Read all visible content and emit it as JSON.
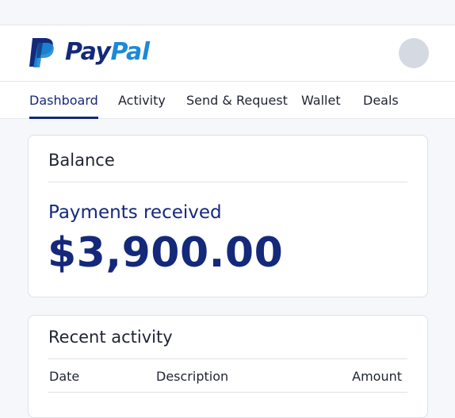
{
  "brand": {
    "name_part1": "Pay",
    "name_part2": "Pal",
    "colors": {
      "navy": "#14297a",
      "blue": "#1c8ad8"
    }
  },
  "header": {
    "avatar_icon": "user-avatar"
  },
  "nav": {
    "tabs": [
      {
        "label": "Dashboard",
        "active": true
      },
      {
        "label": "Activity"
      },
      {
        "label": "Send & Request"
      },
      {
        "label": "Wallet"
      },
      {
        "label": "Deals"
      }
    ]
  },
  "balance": {
    "title": "Balance",
    "label": "Payments received",
    "amount": "$3,900.00"
  },
  "activity": {
    "title": "Recent activity",
    "columns": [
      "Date",
      "Description",
      "Amount"
    ]
  }
}
